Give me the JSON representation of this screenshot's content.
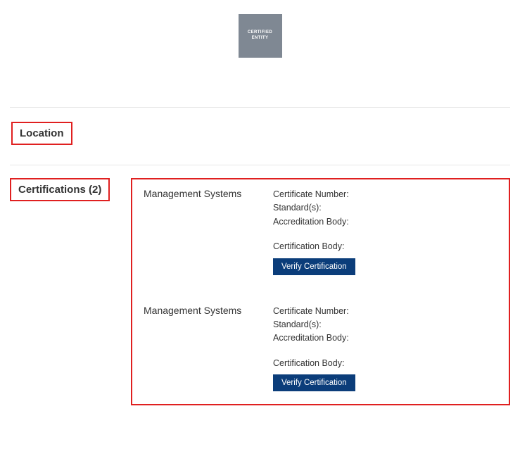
{
  "logo": {
    "line1": "CERTIFIED",
    "line2": "ENTITY"
  },
  "sections": {
    "location_label": "Location",
    "certifications_label": "Certifications (2)"
  },
  "certifications": [
    {
      "type": "Management Systems",
      "certificate_number_label": "Certificate Number:",
      "standards_label": "Standard(s):",
      "accreditation_body_label": "Accreditation Body:",
      "certification_body_label": "Certification Body:",
      "verify_label": "Verify Certification"
    },
    {
      "type": "Management Systems",
      "certificate_number_label": "Certificate Number:",
      "standards_label": "Standard(s):",
      "accreditation_body_label": "Accreditation Body:",
      "certification_body_label": "Certification Body:",
      "verify_label": "Verify Certification"
    }
  ]
}
